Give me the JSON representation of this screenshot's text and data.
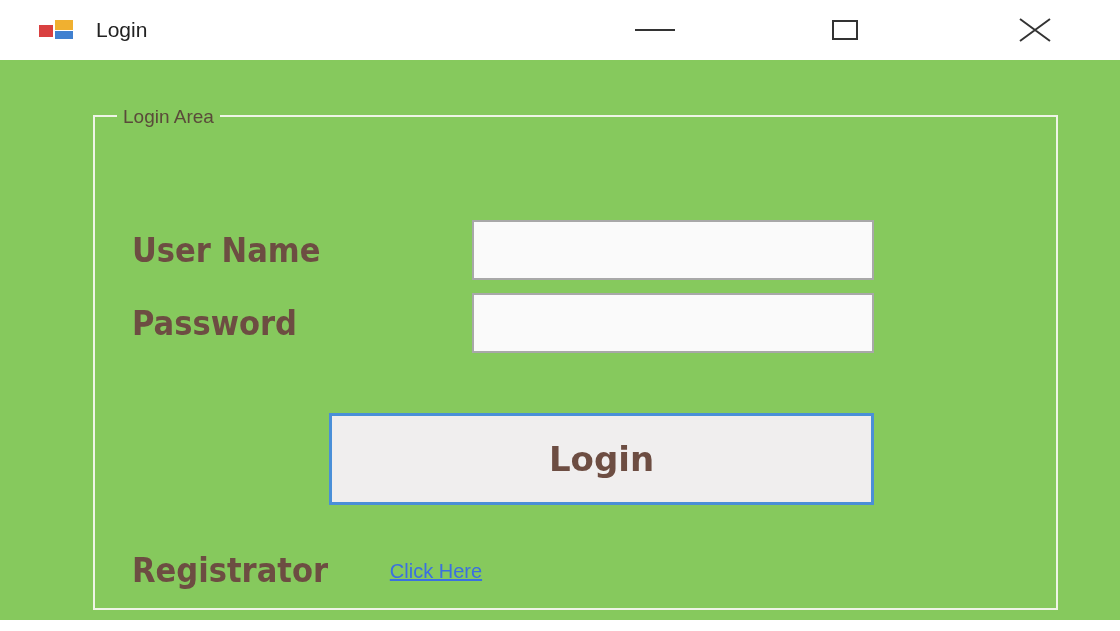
{
  "window": {
    "title": "Login"
  },
  "group": {
    "title": "Login Area"
  },
  "fields": [
    {
      "label": "User Name"
    },
    {
      "label": "Password"
    }
  ],
  "login_button": {
    "label": "Login"
  },
  "register": {
    "label": "Registrator",
    "link": "Click Here"
  }
}
